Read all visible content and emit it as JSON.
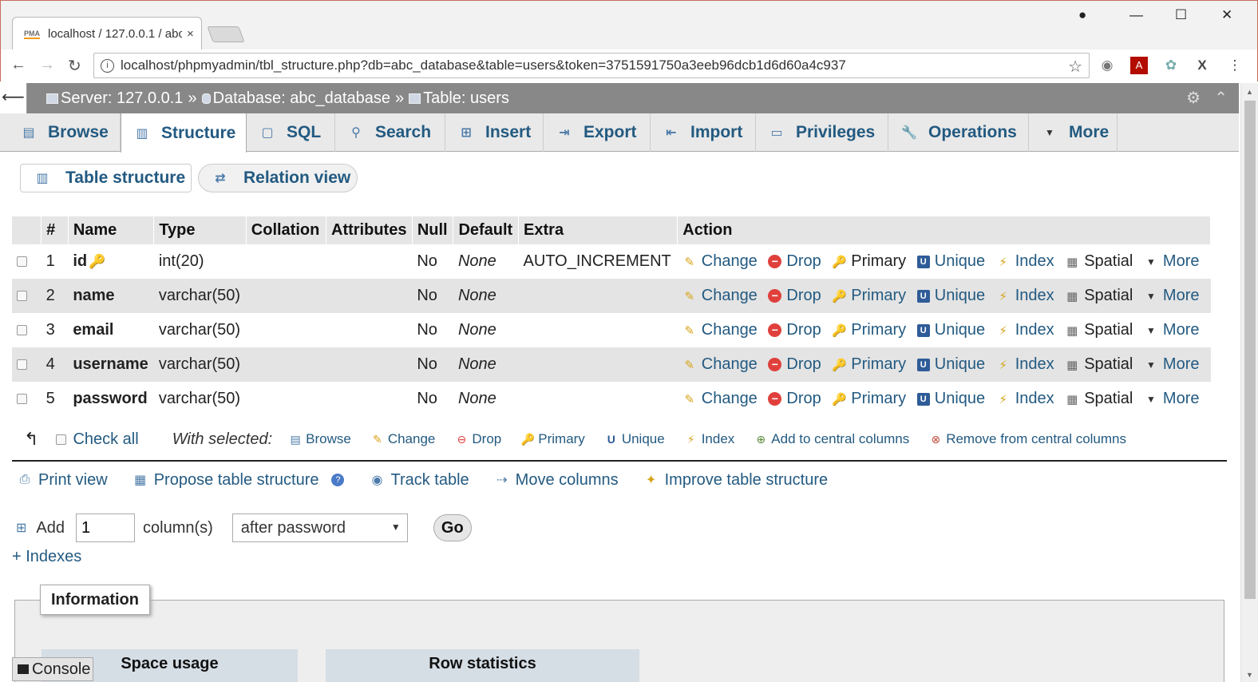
{
  "browser": {
    "tab_title": "localhost / 127.0.0.1 / abc",
    "tab_close": "×",
    "favicon": "PMA",
    "url": "localhost/phpmyadmin/tbl_structure.php?db=abc_database&table=users&token=3751591750a3eeb96dcb1d6d60a4c937",
    "icons": [
      "back-arrow-icon",
      "forward-arrow-icon",
      "reload-icon",
      "info-icon",
      "star-icon",
      "account-icon",
      "minimize-icon",
      "maximize-icon",
      "close-icon"
    ]
  },
  "breadcrumb": {
    "server": "Server: 127.0.0.1",
    "sep1": "»",
    "database": "Database: abc_database",
    "sep2": "»",
    "table": "Table: users"
  },
  "tabs": [
    {
      "label": "Browse",
      "icon": "browse-icon"
    },
    {
      "label": "Structure",
      "icon": "structure-icon",
      "active": true
    },
    {
      "label": "SQL",
      "icon": "sql-icon"
    },
    {
      "label": "Search",
      "icon": "search-icon"
    },
    {
      "label": "Insert",
      "icon": "insert-icon"
    },
    {
      "label": "Export",
      "icon": "export-icon"
    },
    {
      "label": "Import",
      "icon": "import-icon"
    },
    {
      "label": "Privileges",
      "icon": "privileges-icon"
    },
    {
      "label": "Operations",
      "icon": "wrench-icon"
    },
    {
      "label": "More",
      "icon": "dropdown-arrow-icon"
    }
  ],
  "subtabs": {
    "table_structure": "Table structure",
    "relation_view": "Relation view"
  },
  "table": {
    "headers": [
      "#",
      "Name",
      "Type",
      "Collation",
      "Attributes",
      "Null",
      "Default",
      "Extra",
      "Action"
    ],
    "rows": [
      {
        "num": "1",
        "name": "id",
        "type": "int(20)",
        "null": "No",
        "default": "None",
        "extra": "AUTO_INCREMENT",
        "is_primary": true
      },
      {
        "num": "2",
        "name": "name",
        "type": "varchar(50)",
        "null": "No",
        "default": "None",
        "extra": ""
      },
      {
        "num": "3",
        "name": "email",
        "type": "varchar(50)",
        "null": "No",
        "default": "None",
        "extra": ""
      },
      {
        "num": "4",
        "name": "username",
        "type": "varchar(50)",
        "null": "No",
        "default": "None",
        "extra": ""
      },
      {
        "num": "5",
        "name": "password",
        "type": "varchar(50)",
        "null": "No",
        "default": "None",
        "extra": ""
      }
    ],
    "actions": {
      "change": "Change",
      "drop": "Drop",
      "primary": "Primary",
      "unique": "Unique",
      "index": "Index",
      "spatial": "Spatial",
      "more": "More"
    }
  },
  "with_selected": {
    "check_all": "Check all",
    "label": "With selected:",
    "browse": "Browse",
    "change": "Change",
    "drop": "Drop",
    "primary": "Primary",
    "unique": "Unique",
    "index": "Index",
    "add_central": "Add to central columns",
    "remove_central": "Remove from central columns"
  },
  "links": {
    "print_view": "Print view",
    "propose": "Propose table structure",
    "track": "Track table",
    "move": "Move columns",
    "improve": "Improve table structure"
  },
  "add_column": {
    "label": "Add",
    "value": "1",
    "suffix": "column(s)",
    "position": "after password",
    "go": "Go"
  },
  "indexes_link": "+ Indexes",
  "information": {
    "legend": "Information",
    "space_usage": "Space usage",
    "row_statistics": "Row statistics"
  },
  "console": "Console",
  "colors": {
    "link": "#235a81",
    "header_bar": "#888888",
    "row_alt": "#e4e4e4",
    "drop_red": "#e0403c"
  }
}
